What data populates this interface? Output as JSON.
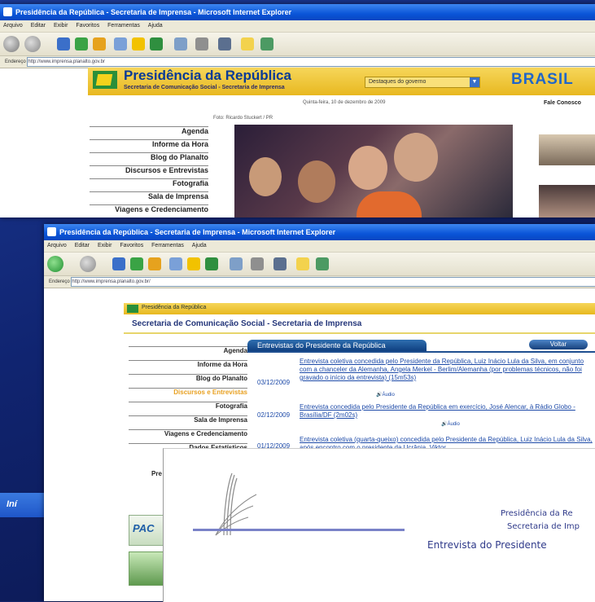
{
  "window1": {
    "title": "Presidência da República - Secretaria de Imprensa - Microsoft Internet Explorer",
    "menu": [
      "Arquivo",
      "Editar",
      "Exibir",
      "Favoritos",
      "Ferramentas",
      "Ajuda"
    ],
    "address_label": "Endereço",
    "address": "http://www.imprensa.planalto.gov.br",
    "header_title": "Presidência da República",
    "header_subtitle": "Secretaria de Comunicação Social - Secretaria de Imprensa",
    "select_value": "Destaques do governo",
    "brasil_logo": "BRASIL",
    "date_text": "Quinta-feira, 10 de dezembro de 2009",
    "contact_link": "Fale Conosco",
    "photo_credit": "Foto: Ricardo Stuckert / PR",
    "nav": [
      "Agenda",
      "Informe da Hora",
      "Blog do Planalto",
      "Discursos e Entrevistas",
      "Fotografia",
      "Sala de Imprensa",
      "Viagens e Credenciamento"
    ]
  },
  "window2": {
    "title": "Presidência da República - Secretaria de Imprensa - Microsoft Internet Explorer",
    "menu": [
      "Arquivo",
      "Editar",
      "Exibir",
      "Favoritos",
      "Ferramentas",
      "Ajuda"
    ],
    "address_label": "Endereço",
    "address": "http://www.imprensa.planalto.gov.br/",
    "top_band": "Presidência da República",
    "header": "Secretaria de Comunicação Social - Secretaria de Imprensa",
    "tab_label": "Entrevistas do Presidente da República",
    "back_button": "Voltar",
    "nav": [
      "Agenda",
      "Informe da Hora",
      "Blog do Planalto",
      "Discursos e Entrevistas",
      "Fotografia",
      "Sala de Imprensa",
      "Viagens e Credenciamento",
      "Dados Estatísticos"
    ],
    "nav_partial": "Pre",
    "entries": [
      {
        "date": "03/12/2009",
        "text": "Entrevista coletiva concedida pelo Presidente da República, Luiz Inácio Lula da Silva, em conjunto com a chanceler da Alemanha, Angela Merkel - Berlim/Alemanha (por problemas técnicos, não foi gravado o início da entrevista) (15m53s)",
        "audio": "Áudio"
      },
      {
        "date": "02/12/2009",
        "text": "Entrevista concedida pelo Presidente da República em exercício, José Alencar, à Rádio Globo - Brasília/DF (2m02s)",
        "audio": "Áudio"
      },
      {
        "date": "01/12/2009",
        "text": "Entrevista coletiva (quarta-queixo) concedida pelo Presidente da República, Luiz Inácio Lula da Silva, após encontro com o presidente da Ucrânia, Viktor"
      }
    ],
    "pac_label": "PAC"
  },
  "slide": {
    "line1": "Presidência da Re",
    "line2": "Secretaria de Imp",
    "line3": "Entrevista do Presidente"
  },
  "taskbar": {
    "start_label": "Iní"
  }
}
